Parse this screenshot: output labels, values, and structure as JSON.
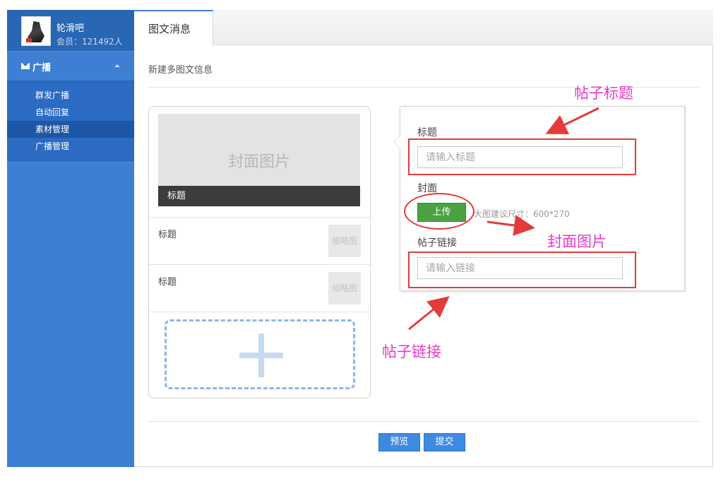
{
  "account": {
    "name": "轮滑吧",
    "members": "会员：121492人"
  },
  "sidebar": {
    "menu_title": "广播",
    "items": [
      {
        "label": "群发广播"
      },
      {
        "label": "自动回复"
      },
      {
        "label": "素材管理",
        "active": true
      },
      {
        "label": "广播管理"
      }
    ]
  },
  "tabs": [
    {
      "label": "图文消息"
    }
  ],
  "main": {
    "section_title": "新建多图文信息"
  },
  "article_list": {
    "cover_placeholder": "封面图片",
    "cover_title": "标题",
    "rows": [
      {
        "title": "标题",
        "thumb": "缩略图"
      },
      {
        "title": "标题",
        "thumb": "缩略图"
      }
    ]
  },
  "editor": {
    "title_label": "标题",
    "title_placeholder": "请输入标题",
    "cover_label": "封面",
    "upload_label": "上传",
    "cover_hint": "大图建议尺寸：600*270",
    "link_label": "帖子链接",
    "link_placeholder": "请输入链接"
  },
  "actions": {
    "preview_label": "预览",
    "submit_label": "提交"
  },
  "annotations": {
    "title_note": "帖子标题",
    "cover_note": "封面图片",
    "link_note": "帖子链接"
  },
  "colors": {
    "sidebar": "#3d7fd3",
    "accent_blue": "#3d8ae3",
    "upload_green": "#4aa241",
    "annotation_red": "#e33b3b",
    "annotation_text": "#e63cc9"
  }
}
